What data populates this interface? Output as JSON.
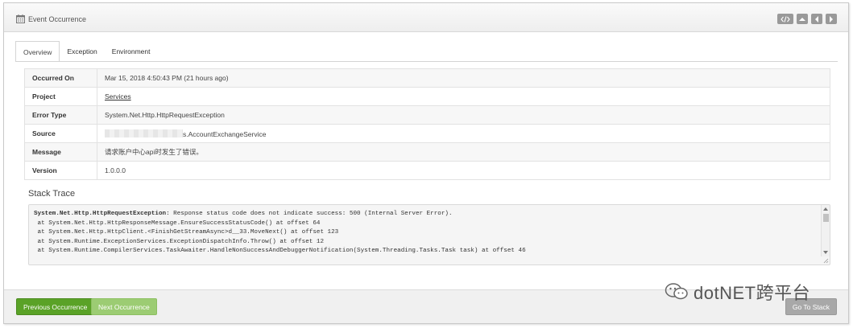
{
  "header": {
    "title": "Event Occurrence",
    "icons": [
      "calendar-icon",
      "code-icon",
      "caret-up-icon",
      "caret-left-icon",
      "caret-right-icon"
    ]
  },
  "tabs": [
    {
      "label": "Overview",
      "active": true
    },
    {
      "label": "Exception",
      "active": false
    },
    {
      "label": "Environment",
      "active": false
    }
  ],
  "details": {
    "occurred_on": {
      "key": "Occurred On",
      "value": "Mar 15, 2018 4:50:43 PM (21 hours ago)"
    },
    "project": {
      "key": "Project",
      "value": "Services"
    },
    "error_type": {
      "key": "Error Type",
      "value": "System.Net.Http.HttpRequestException"
    },
    "source": {
      "key": "Source",
      "value": "s.AccountExchangeService"
    },
    "message": {
      "key": "Message",
      "value": "请求账户中心api时发生了错误。"
    },
    "version": {
      "key": "Version",
      "value": "1.0.0.0"
    }
  },
  "stack": {
    "title": "Stack Trace",
    "exception_type": "System.Net.Http.HttpRequestException",
    "exception_message": ": Response status code does not indicate success: 500 (Internal Server Error).",
    "lines": [
      " at System.Net.Http.HttpResponseMessage.EnsureSuccessStatusCode() at offset 64",
      " at System.Net.Http.HttpClient.<FinishGetStreamAsync>d__33.MoveNext() at offset 123",
      " at System.Runtime.ExceptionServices.ExceptionDispatchInfo.Throw() at offset 12",
      " at System.Runtime.CompilerServices.TaskAwaiter.HandleNonSuccessAndDebuggerNotification(System.Threading.Tasks.Task task) at offset 46"
    ]
  },
  "footer": {
    "prev_label": "Previous Occurrence",
    "next_label": "Next Occurrence",
    "stack_label": "Go To Stack"
  },
  "watermark": {
    "text": "dotNET跨平台"
  },
  "colors": {
    "primary_green": "#5aa227",
    "light_green": "#9ccc73",
    "gray_button": "#a8a8a8"
  }
}
